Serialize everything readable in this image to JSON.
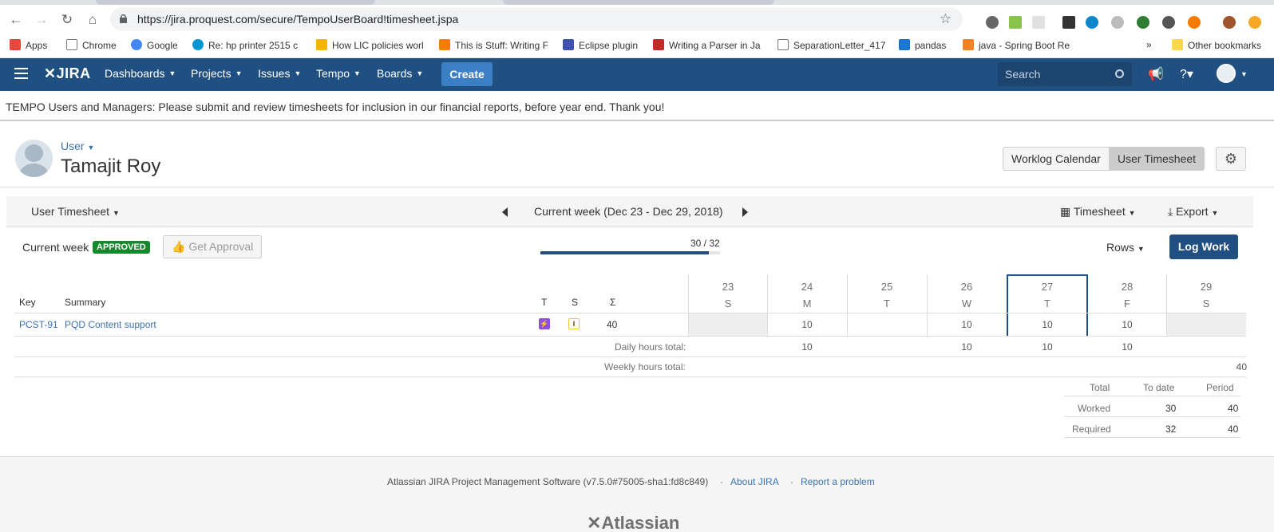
{
  "browser": {
    "url": "https://jira.proquest.com/secure/TempoUserBoard!timesheet.jspa",
    "bookmarks": [
      "Apps",
      "Chrome",
      "Google",
      "Re: hp printer 2515 c",
      "How LIC policies worl",
      "This is Stuff: Writing F",
      "Eclipse plugin",
      "Writing a Parser in Ja",
      "SeparationLetter_417",
      "pandas",
      "java - Spring Boot Re"
    ],
    "more_bookmarks": "»",
    "other_bookmarks": "Other bookmarks"
  },
  "header": {
    "logo": "JIRA",
    "nav": [
      "Dashboards",
      "Projects",
      "Issues",
      "Tempo",
      "Boards"
    ],
    "create": "Create",
    "search_placeholder": "Search",
    "brand_color": "#205081"
  },
  "banner": "TEMPO Users and Managers: Please submit and review timesheets for inclusion in our financial reports, before year end. Thank you!",
  "user": {
    "label": "User",
    "name": "Tamajit Roy"
  },
  "view_buttons": {
    "calendar": "Worklog Calendar",
    "timesheet": "User Timesheet"
  },
  "toolbar": {
    "view": "User Timesheet",
    "period": "Current week (Dec 23 - Dec 29, 2018)",
    "timesheet": "Timesheet",
    "export": "Export"
  },
  "status": {
    "label": "Current week",
    "badge": "APPROVED",
    "get_approval": "Get Approval",
    "progress_text": "30 / 32",
    "progress_fraction": 0.9375,
    "rows": "Rows",
    "log_work": "Log Work"
  },
  "grid": {
    "headers": {
      "key": "Key",
      "summary": "Summary",
      "t": "T",
      "s": "S",
      "sigma": "Σ"
    },
    "days": [
      {
        "num": "23",
        "dow": "S"
      },
      {
        "num": "24",
        "dow": "M"
      },
      {
        "num": "25",
        "dow": "T"
      },
      {
        "num": "26",
        "dow": "W"
      },
      {
        "num": "27",
        "dow": "T"
      },
      {
        "num": "28",
        "dow": "F"
      },
      {
        "num": "29",
        "dow": "S"
      }
    ],
    "row": {
      "key": "PCST-91",
      "summary": "PQD Content support",
      "status_letter": "I",
      "total": "40",
      "hours": [
        "",
        "10",
        "",
        "10",
        "10",
        "10",
        ""
      ]
    },
    "daily_label": "Daily hours total:",
    "daily": [
      "",
      "10",
      "",
      "10",
      "10",
      "10",
      ""
    ],
    "weekly_label": "Weekly hours total:",
    "weekly": "40"
  },
  "summary": {
    "headers": [
      "Total",
      "To date",
      "Period"
    ],
    "worked": {
      "label": "Worked",
      "to_date": "30",
      "period": "40"
    },
    "required": {
      "label": "Required",
      "to_date": "32",
      "period": "40"
    }
  },
  "footer": {
    "version": "Atlassian JIRA Project Management Software (v7.5.0#75005-sha1:fd8c849)",
    "about": "About JIRA",
    "report": "Report a problem",
    "sep": "·",
    "logo": "Atlassian"
  }
}
